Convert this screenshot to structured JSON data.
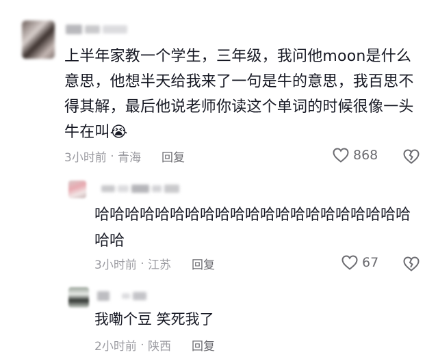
{
  "comments": [
    {
      "text": "上半年家教一个学生，三年级，我问他moon是什么意思，他想半天给我来了一句是牛的意思，我百思不得其解，最后他说老师你读这个单词的时候很像一头牛在叫",
      "emoji": "😭",
      "time": "3小时前",
      "location": "青海",
      "reply_label": "回复",
      "likes": "868"
    },
    {
      "text": "哈哈哈哈哈哈哈哈哈哈哈哈哈哈哈哈哈哈哈哈哈哈哈",
      "time": "3小时前",
      "location": "江苏",
      "reply_label": "回复",
      "likes": "67"
    },
    {
      "text": "我嘞个豆 笑死我了",
      "time": "2小时前",
      "location": "陕西",
      "reply_label": "回复"
    }
  ],
  "meta_separator": " · ",
  "icons": {
    "like": "heart-icon",
    "dislike": "broken-heart-icon"
  },
  "colors": {
    "text": "#161823",
    "meta": "#9b9ba1",
    "icon": "#6b6b70"
  }
}
